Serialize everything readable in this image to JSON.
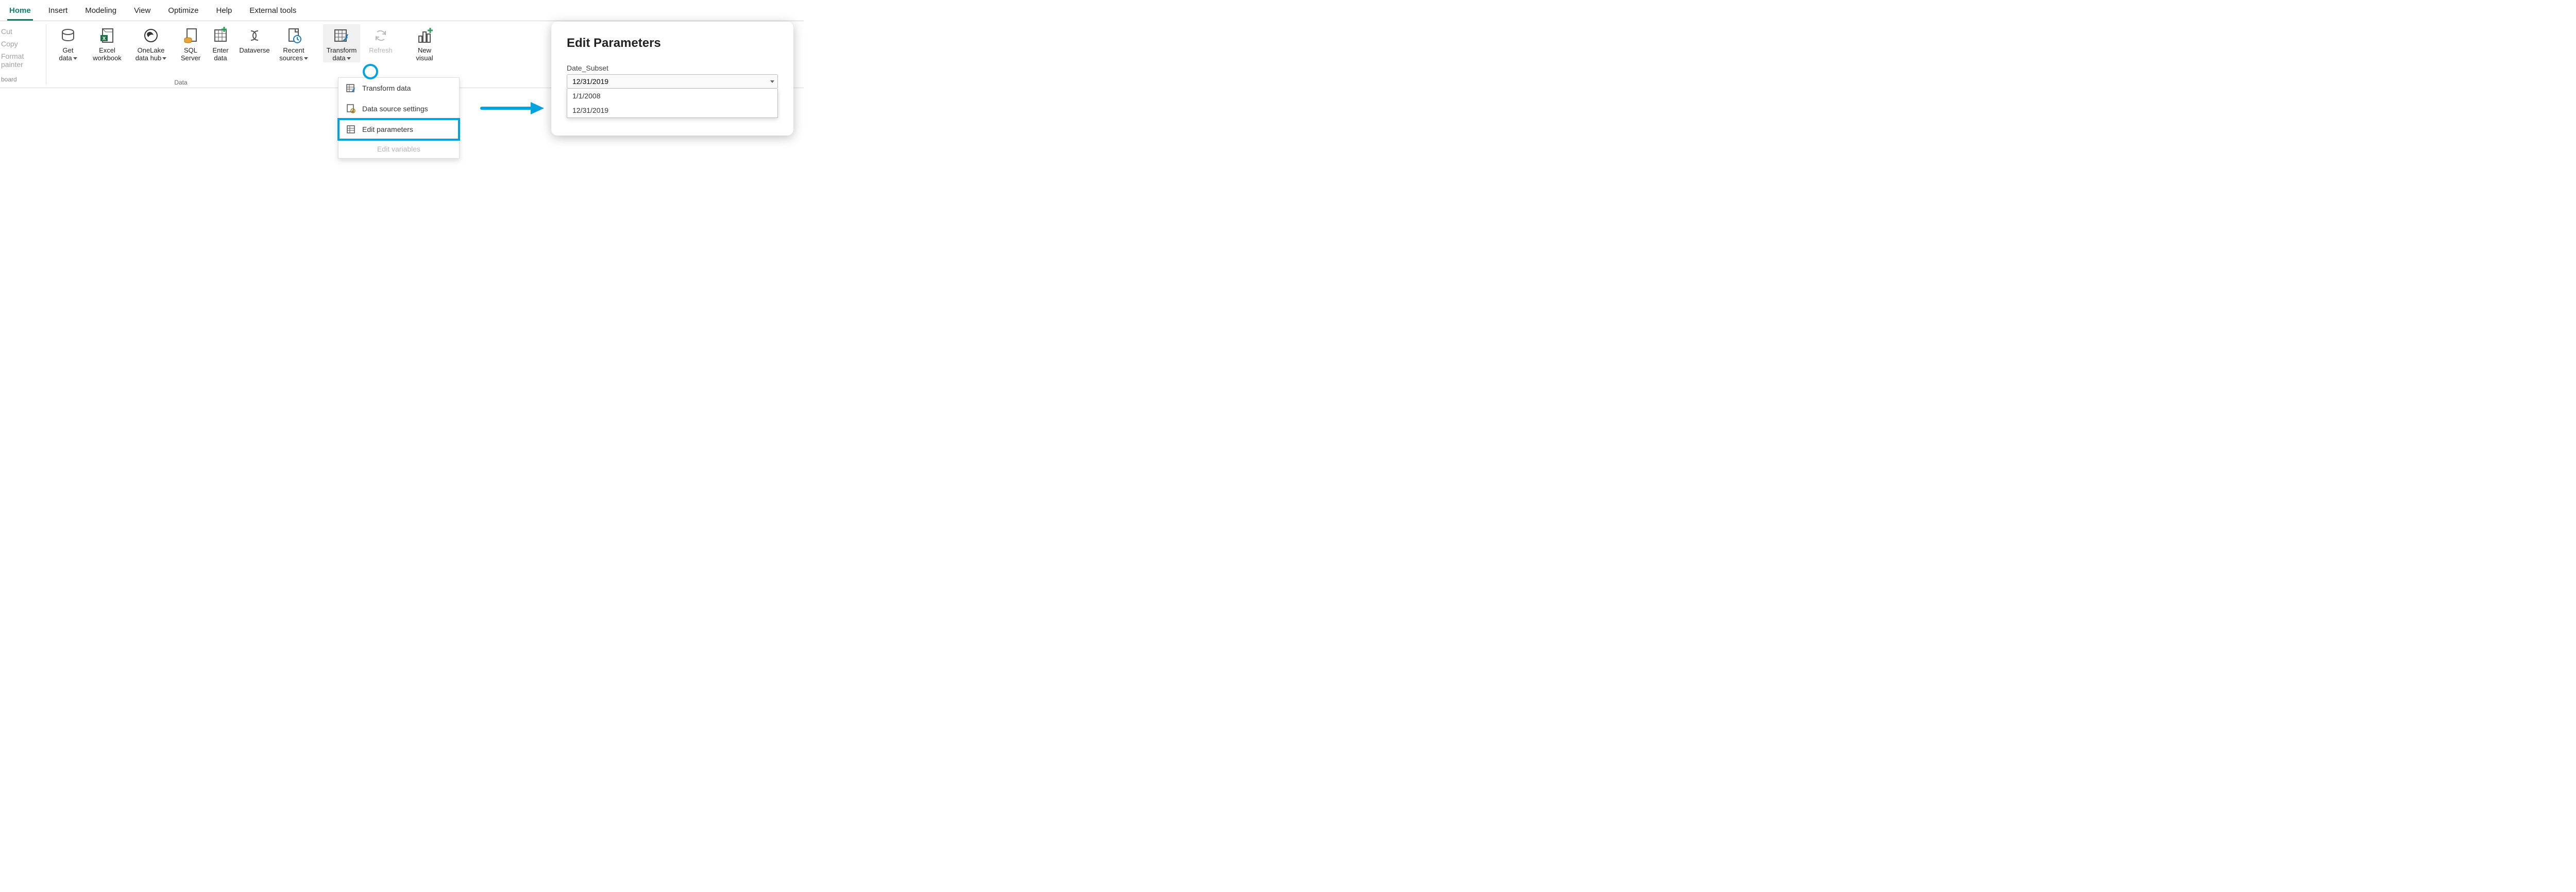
{
  "tabs": {
    "home": "Home",
    "insert": "Insert",
    "modeling": "Modeling",
    "view": "View",
    "optimize": "Optimize",
    "help": "Help",
    "external": "External tools"
  },
  "clipboard": {
    "cut": "Cut",
    "copy": "Copy",
    "format_painter": "Format painter",
    "group_label": "board"
  },
  "ribbon": {
    "get_data": "Get",
    "get_data_sub": "data",
    "excel_workbook": "Excel",
    "excel_workbook_sub": "workbook",
    "onelake": "OneLake",
    "onelake_sub": "data hub",
    "sql_server": "SQL",
    "sql_server_sub": "Server",
    "enter_data": "Enter",
    "enter_data_sub": "data",
    "dataverse": "Dataverse",
    "recent_sources": "Recent",
    "recent_sources_sub": "sources",
    "transform_data": "Transform",
    "transform_data_sub": "data",
    "refresh": "Refresh",
    "new_visual": "New",
    "new_visual_sub": "visual",
    "data_group_label": "Data"
  },
  "dropdown": {
    "transform_data": "Transform data",
    "data_source_settings": "Data source settings",
    "edit_parameters": "Edit parameters",
    "edit_variables": "Edit variables"
  },
  "dialog": {
    "title": "Edit Parameters",
    "field_label": "Date_Subset",
    "selected": "12/31/2019",
    "options": [
      "1/1/2008",
      "12/31/2019"
    ]
  }
}
